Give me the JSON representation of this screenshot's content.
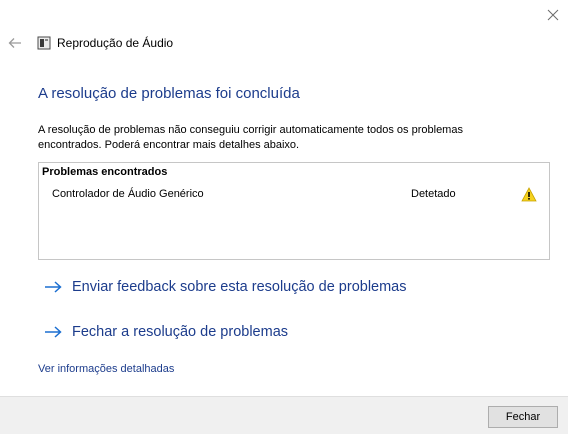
{
  "window": {
    "close_icon": "close-icon",
    "back_icon": "back-arrow-icon"
  },
  "wizard": {
    "icon": "troubleshooter-icon",
    "title": "Reprodução de Áudio"
  },
  "main": {
    "heading": "A resolução de problemas foi concluída",
    "description": "A resolução de problemas não conseguiu corrigir automaticamente todos os problemas encontrados. Poderá encontrar mais detalhes abaixo."
  },
  "problems": {
    "header": "Problemas encontrados",
    "items": [
      {
        "name": "Controlador de Áudio Genérico",
        "status": "Detetado",
        "icon": "warning-icon"
      }
    ]
  },
  "links": {
    "feedback": "Enviar feedback sobre esta resolução de problemas",
    "close_troubleshooter": "Fechar a resolução de problemas",
    "details": "Ver informações detalhadas"
  },
  "footer": {
    "close_button": "Fechar"
  },
  "colors": {
    "link": "#1c3c8c",
    "warning": "#f5d21f"
  }
}
